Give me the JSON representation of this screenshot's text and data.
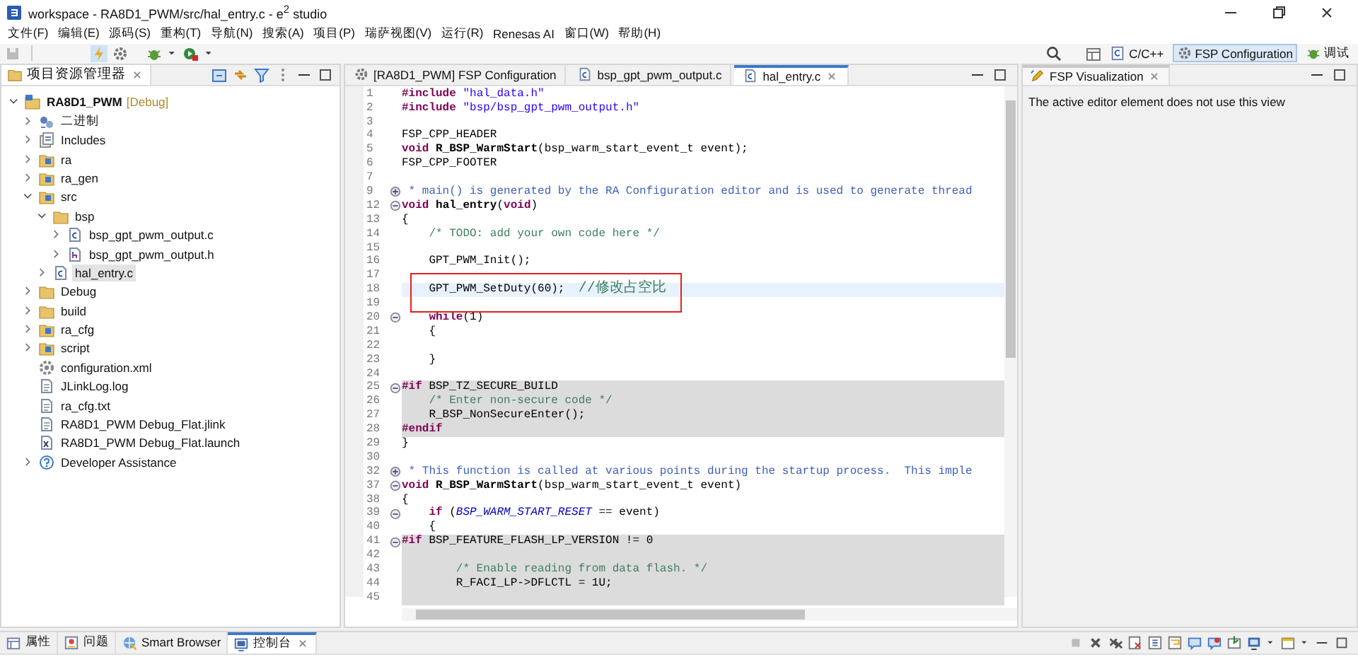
{
  "window": {
    "title": "workspace - RA8D1_PWM/src/hal_entry.c - e$^{2}$ studio"
  },
  "menu": [
    "文件(F)",
    "编辑(E)",
    "源码(S)",
    "重构(T)",
    "导航(N)",
    "搜索(A)",
    "项目(P)",
    "瑞萨视图(V)",
    "运行(R)",
    "Renesas AI",
    "窗口(W)",
    "帮助(H)"
  ],
  "perspectives": [
    {
      "label": "C/C++",
      "kind": "cpp",
      "selected": false
    },
    {
      "label": "FSP Configuration",
      "kind": "gear",
      "selected": true
    },
    {
      "label": "调试",
      "kind": "bug",
      "selected": false
    }
  ],
  "explorer": {
    "title": "项目资源管理器",
    "tree": [
      {
        "label": "RA8D1_PWM",
        "badge": "[Debug]",
        "kind": "project",
        "expanded": true,
        "selected": false,
        "children": [
          {
            "label": "二进制",
            "kind": "binaries",
            "expanded": false,
            "selected": false
          },
          {
            "label": "Includes",
            "kind": "includes",
            "expanded": false,
            "selected": false
          },
          {
            "label": "ra",
            "kind": "srcfolder",
            "expanded": false,
            "selected": false
          },
          {
            "label": "ra_gen",
            "kind": "srcfolder",
            "expanded": false,
            "selected": false
          },
          {
            "label": "src",
            "kind": "srcfolder",
            "expanded": true,
            "selected": false,
            "children": [
              {
                "label": "bsp",
                "kind": "folder",
                "expanded": true,
                "selected": false,
                "children": [
                  {
                    "label": "bsp_gpt_pwm_output.c",
                    "kind": "file-c",
                    "expanded": false,
                    "selected": false
                  },
                  {
                    "label": "bsp_gpt_pwm_output.h",
                    "kind": "file-h",
                    "expanded": false,
                    "selected": false
                  }
                ]
              },
              {
                "label": "hal_entry.c",
                "kind": "file-c",
                "expanded": false,
                "selected": true
              }
            ]
          },
          {
            "label": "Debug",
            "kind": "folder",
            "expanded": false,
            "selected": false
          },
          {
            "label": "build",
            "kind": "folder",
            "expanded": false,
            "selected": false
          },
          {
            "label": "ra_cfg",
            "kind": "srcfolder",
            "expanded": false,
            "selected": false
          },
          {
            "label": "script",
            "kind": "srcfolder",
            "expanded": false,
            "selected": false
          },
          {
            "label": "configuration.xml",
            "kind": "config",
            "selected": false
          },
          {
            "label": "JLinkLog.log",
            "kind": "text",
            "selected": false
          },
          {
            "label": "ra_cfg.txt",
            "kind": "text",
            "selected": false
          },
          {
            "label": "RA8D1_PWM Debug_Flat.jlink",
            "kind": "text",
            "selected": false
          },
          {
            "label": "RA8D1_PWM Debug_Flat.launch",
            "kind": "launch",
            "selected": false
          },
          {
            "label": "Developer Assistance",
            "kind": "help",
            "expanded": false,
            "selected": false
          }
        ]
      }
    ]
  },
  "editor": {
    "tabs": [
      {
        "label": "[RA8D1_PWM] FSP Configuration",
        "kind": "gear",
        "selected": false
      },
      {
        "label": "bsp_gpt_pwm_output.c",
        "kind": "file-c",
        "selected": false
      },
      {
        "label": "hal_entry.c",
        "kind": "file-c",
        "selected": true
      }
    ],
    "lines": [
      {
        "no": "1",
        "shaded": false,
        "current": false,
        "boxed": false,
        "tokens": [
          {
            "kind": "pre",
            "text": "#include "
          },
          {
            "kind": "str",
            "text": "\"hal_data.h\""
          }
        ]
      },
      {
        "no": "2",
        "shaded": false,
        "current": false,
        "boxed": false,
        "tokens": [
          {
            "kind": "pre",
            "text": "#include "
          },
          {
            "kind": "str",
            "text": "\"bsp/bsp_gpt_pwm_output.h\""
          }
        ]
      },
      {
        "no": "3",
        "shaded": false,
        "current": false,
        "boxed": false
      },
      {
        "no": "4",
        "shaded": false,
        "current": false,
        "boxed": false,
        "tokens": [
          {
            "kind": "tx",
            "text": "FSP_CPP_HEADER"
          }
        ]
      },
      {
        "no": "5",
        "shaded": false,
        "current": false,
        "boxed": false,
        "tokens": [
          {
            "kind": "kw",
            "text": "void "
          },
          {
            "kind": "fn",
            "text": "R_BSP_WarmStart"
          },
          {
            "kind": "tx",
            "text": "(bsp_warm_start_event_t event);"
          }
        ]
      },
      {
        "no": "6",
        "shaded": false,
        "current": false,
        "boxed": false,
        "tokens": [
          {
            "kind": "tx",
            "text": "FSP_CPP_FOOTER"
          }
        ]
      },
      {
        "no": "7",
        "shaded": false,
        "current": false,
        "boxed": false
      },
      {
        "no": "9",
        "collapsed": true,
        "shaded": false,
        "current": false,
        "boxed": false,
        "tokens": [
          {
            "kind": "doc",
            "text": " * main() is generated by the RA Configuration editor and is used to generate thread"
          }
        ]
      },
      {
        "no": "12",
        "collapsed": false,
        "shaded": false,
        "current": false,
        "boxed": false,
        "tokens": [
          {
            "kind": "kw",
            "text": "void "
          },
          {
            "kind": "fn",
            "text": "hal_entry"
          },
          {
            "kind": "tx",
            "text": "("
          },
          {
            "kind": "kw",
            "text": "void"
          },
          {
            "kind": "tx",
            "text": ")"
          }
        ]
      },
      {
        "no": "13",
        "shaded": false,
        "current": false,
        "boxed": false,
        "tokens": [
          {
            "kind": "tx",
            "text": "{"
          }
        ]
      },
      {
        "no": "14",
        "shaded": false,
        "current": false,
        "boxed": false,
        "tokens": [
          {
            "kind": "cm",
            "text": "    /* TODO: add your own code here */"
          }
        ]
      },
      {
        "no": "15",
        "shaded": false,
        "current": false,
        "boxed": false
      },
      {
        "no": "16",
        "shaded": false,
        "current": false,
        "boxed": false,
        "tokens": [
          {
            "kind": "tx",
            "text": "    GPT_PWM_Init();"
          }
        ]
      },
      {
        "no": "17",
        "shaded": false,
        "current": false,
        "boxed": true
      },
      {
        "no": "18",
        "shaded": false,
        "current": true,
        "boxed": true,
        "tokens": [
          {
            "kind": "tx",
            "text": "    GPT_PWM_SetDuty(60);  "
          },
          {
            "kind": "cm",
            "text": "//修改占空比"
          }
        ]
      },
      {
        "no": "19",
        "shaded": false,
        "current": false,
        "boxed": true
      },
      {
        "no": "20",
        "collapsed": false,
        "shaded": false,
        "current": false,
        "boxed": false,
        "tokens": [
          {
            "kind": "kw",
            "text": "    while"
          },
          {
            "kind": "tx",
            "text": "(1)"
          }
        ]
      },
      {
        "no": "21",
        "shaded": false,
        "current": false,
        "boxed": false,
        "tokens": [
          {
            "kind": "tx",
            "text": "    {"
          }
        ]
      },
      {
        "no": "22",
        "shaded": false,
        "current": false,
        "boxed": false
      },
      {
        "no": "23",
        "shaded": false,
        "current": false,
        "boxed": false,
        "tokens": [
          {
            "kind": "tx",
            "text": "    }"
          }
        ]
      },
      {
        "no": "24",
        "shaded": false,
        "current": false,
        "boxed": false
      },
      {
        "no": "25",
        "collapsed": false,
        "shaded": true,
        "current": false,
        "boxed": false,
        "tokens": [
          {
            "kind": "pre",
            "text": "#if "
          },
          {
            "kind": "tx",
            "text": "BSP_TZ_SECURE_BUILD"
          }
        ]
      },
      {
        "no": "26",
        "shaded": true,
        "current": false,
        "boxed": false,
        "tokens": [
          {
            "kind": "cm",
            "text": "    /* Enter non-secure code */"
          }
        ]
      },
      {
        "no": "27",
        "shaded": true,
        "current": false,
        "boxed": false,
        "tokens": [
          {
            "kind": "tx",
            "text": "    R_BSP_NonSecureEnter();"
          }
        ]
      },
      {
        "no": "28",
        "shaded": true,
        "current": false,
        "boxed": false,
        "tokens": [
          {
            "kind": "pre",
            "text": "#endif"
          }
        ]
      },
      {
        "no": "29",
        "shaded": false,
        "current": false,
        "boxed": false,
        "tokens": [
          {
            "kind": "tx",
            "text": "}"
          }
        ]
      },
      {
        "no": "30",
        "shaded": false,
        "current": false,
        "boxed": false
      },
      {
        "no": "32",
        "collapsed": true,
        "shaded": false,
        "current": false,
        "boxed": false,
        "tokens": [
          {
            "kind": "doc",
            "text": " * This function is called at various points during the startup process.  This imple"
          }
        ]
      },
      {
        "no": "37",
        "collapsed": false,
        "shaded": false,
        "current": false,
        "boxed": false,
        "tokens": [
          {
            "kind": "kw",
            "text": "void "
          },
          {
            "kind": "fn",
            "text": "R_BSP_WarmStart"
          },
          {
            "kind": "tx",
            "text": "(bsp_warm_start_event_t event)"
          }
        ]
      },
      {
        "no": "38",
        "shaded": false,
        "current": false,
        "boxed": false,
        "tokens": [
          {
            "kind": "tx",
            "text": "{"
          }
        ]
      },
      {
        "no": "39",
        "collapsed": false,
        "shaded": false,
        "current": false,
        "boxed": false,
        "tokens": [
          {
            "kind": "kw",
            "text": "    if "
          },
          {
            "kind": "tx",
            "text": "("
          },
          {
            "kind": "const",
            "text": "BSP_WARM_START_RESET"
          },
          {
            "kind": "tx",
            "text": " == event)"
          }
        ]
      },
      {
        "no": "40",
        "shaded": false,
        "current": false,
        "boxed": false,
        "tokens": [
          {
            "kind": "tx",
            "text": "    {"
          }
        ]
      },
      {
        "no": "41",
        "collapsed": false,
        "shaded": true,
        "current": false,
        "boxed": false,
        "tokens": [
          {
            "kind": "pre",
            "text": "#if "
          },
          {
            "kind": "tx",
            "text": "BSP_FEATURE_FLASH_LP_VERSION != 0"
          }
        ]
      },
      {
        "no": "42",
        "shaded": true,
        "current": false,
        "boxed": false
      },
      {
        "no": "43",
        "shaded": true,
        "current": false,
        "boxed": false,
        "tokens": [
          {
            "kind": "cm",
            "text": "        /* Enable reading from data flash. */"
          }
        ]
      },
      {
        "no": "44",
        "shaded": true,
        "current": false,
        "boxed": false,
        "tokens": [
          {
            "kind": "tx",
            "text": "        R_FACI_LP->DFLCTL = 1U;"
          }
        ]
      },
      {
        "no": "45",
        "shaded": true,
        "current": false,
        "boxed": false
      }
    ]
  },
  "side_view": {
    "title": "FSP Visualization",
    "message": "The active editor element does not use this view"
  },
  "bottom_tabs": [
    {
      "label": "属性",
      "kind": "properties",
      "selected": false
    },
    {
      "label": "问题",
      "kind": "problems",
      "selected": false
    },
    {
      "label": "Smart Browser",
      "kind": "browser",
      "selected": false
    },
    {
      "label": "控制台",
      "kind": "console",
      "selected": true
    }
  ]
}
